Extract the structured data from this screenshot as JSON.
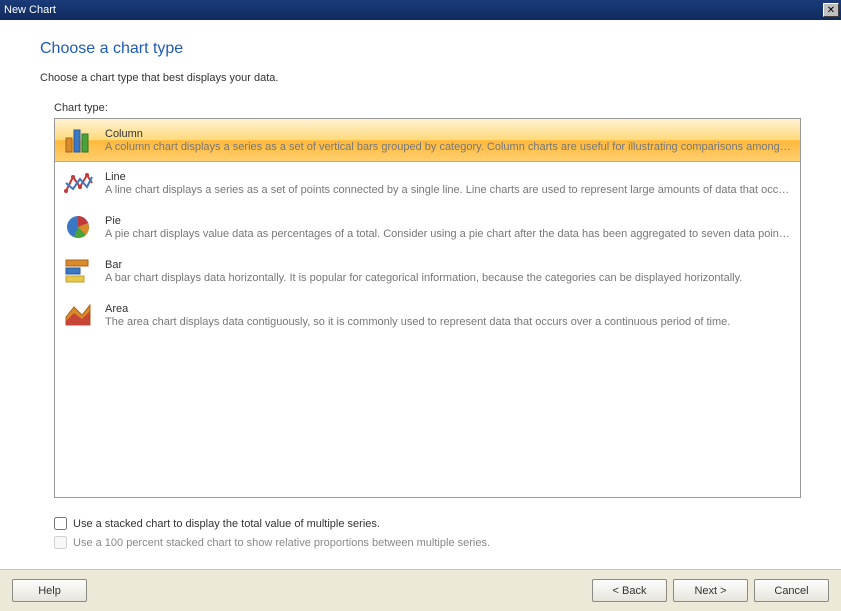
{
  "window": {
    "title": "New Chart"
  },
  "page": {
    "heading": "Choose a chart type",
    "subheading": "Choose a chart type that best displays your data.",
    "chart_type_label": "Chart type:"
  },
  "chart_types": [
    {
      "title": "Column",
      "desc": "A column chart displays a series as a set of vertical bars grouped by category. Column charts are useful for illustrating comparisons among categories."
    },
    {
      "title": "Line",
      "desc": "A line chart displays a series as a set of points connected by a single line. Line charts are used to represent large amounts of data that occur over a continuous period of time."
    },
    {
      "title": "Pie",
      "desc": "A pie chart displays value data as percentages of a total. Consider using a pie chart after the data has been aggregated to seven data points or fewer."
    },
    {
      "title": "Bar",
      "desc": "A bar chart displays data horizontally. It is popular for categorical information, because the categories can be displayed horizontally."
    },
    {
      "title": "Area",
      "desc": "The area chart displays data contiguously, so it is commonly used to represent data that occurs over a continuous period of time."
    }
  ],
  "checkboxes": {
    "stacked": "Use a stacked chart to display the total value of multiple series.",
    "percent_stacked": "Use a 100 percent stacked chart to show relative proportions between multiple series."
  },
  "buttons": {
    "help": "Help",
    "back": "< Back",
    "next": "Next >",
    "cancel": "Cancel"
  }
}
